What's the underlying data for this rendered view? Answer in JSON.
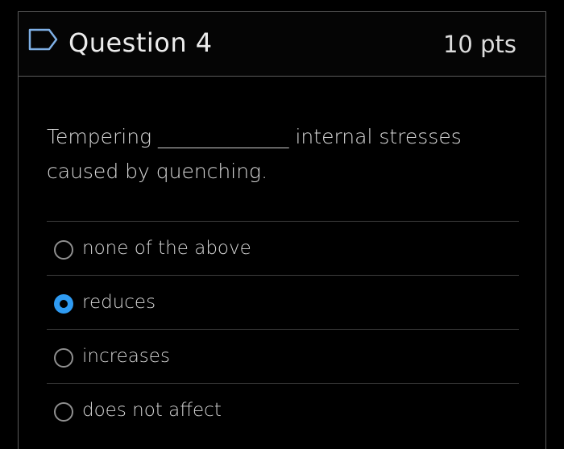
{
  "question": {
    "title": "Question 4",
    "points": "10 pts",
    "text_before_blank": "Tempering ",
    "blank": "_____________",
    "text_after_blank": " internal stresses caused by quenching.",
    "flag_icon": "flag-outline-icon"
  },
  "answers": [
    {
      "label": "none of the above",
      "selected": false
    },
    {
      "label": "reduces",
      "selected": true
    },
    {
      "label": "increases",
      "selected": false
    },
    {
      "label": "does not affect",
      "selected": false
    }
  ],
  "colors": {
    "background": "#000000",
    "border": "#5a5a5a",
    "accent": "#2f9bf2",
    "text": "#e6e6e6"
  }
}
